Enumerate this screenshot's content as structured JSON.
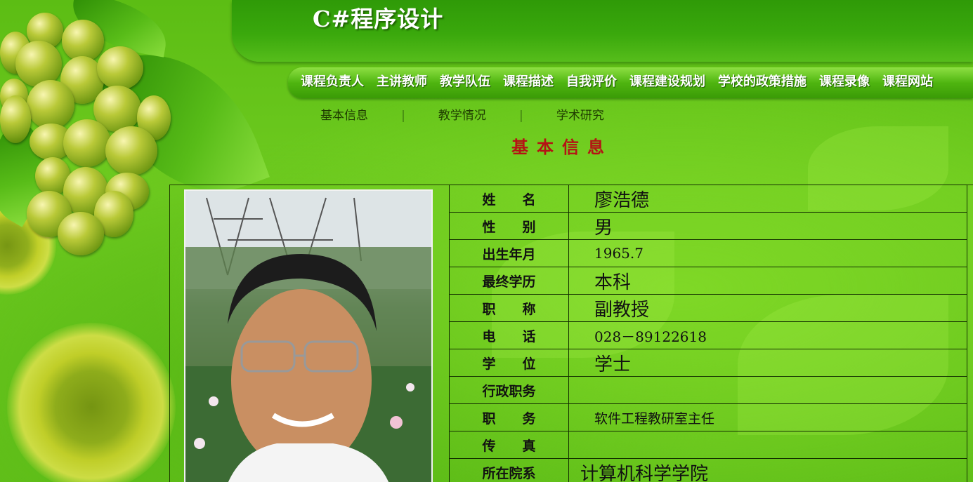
{
  "site": {
    "title": "C#程序设计"
  },
  "nav": {
    "items": [
      "课程负责人",
      "主讲教师",
      "教学队伍",
      "课程描述",
      "自我评价",
      "课程建设规划",
      "学校的政策措施",
      "课程录像",
      "课程网站"
    ]
  },
  "subnav": {
    "items": [
      "基本信息",
      "教学情况",
      "学术研究"
    ],
    "separator": "|"
  },
  "section": {
    "title": "基本信息"
  },
  "profile": {
    "photo_icon": "person-photo",
    "rows": [
      {
        "label": "姓　　名",
        "value": "廖浩德"
      },
      {
        "label": "性　　别",
        "value": "男"
      },
      {
        "label": "出生年月",
        "value": "1965.7"
      },
      {
        "label": "最终学历",
        "value": "本科"
      },
      {
        "label": "职　　称",
        "value": "副教授"
      },
      {
        "label": "电　　话",
        "value": "028－89122618"
      },
      {
        "label": "学　　位",
        "value": "学士"
      },
      {
        "label": "行政职务",
        "value": ""
      },
      {
        "label": "职　　务",
        "value": "软件工程教研室主任"
      },
      {
        "label": "传　　真",
        "value": ""
      },
      {
        "label": "所在院系",
        "value": "计算机科学学院"
      }
    ]
  },
  "colors": {
    "background": "#6fcb20",
    "section_title": "#b41414",
    "nav_text": "#ffffff",
    "table_border": "#143000"
  }
}
